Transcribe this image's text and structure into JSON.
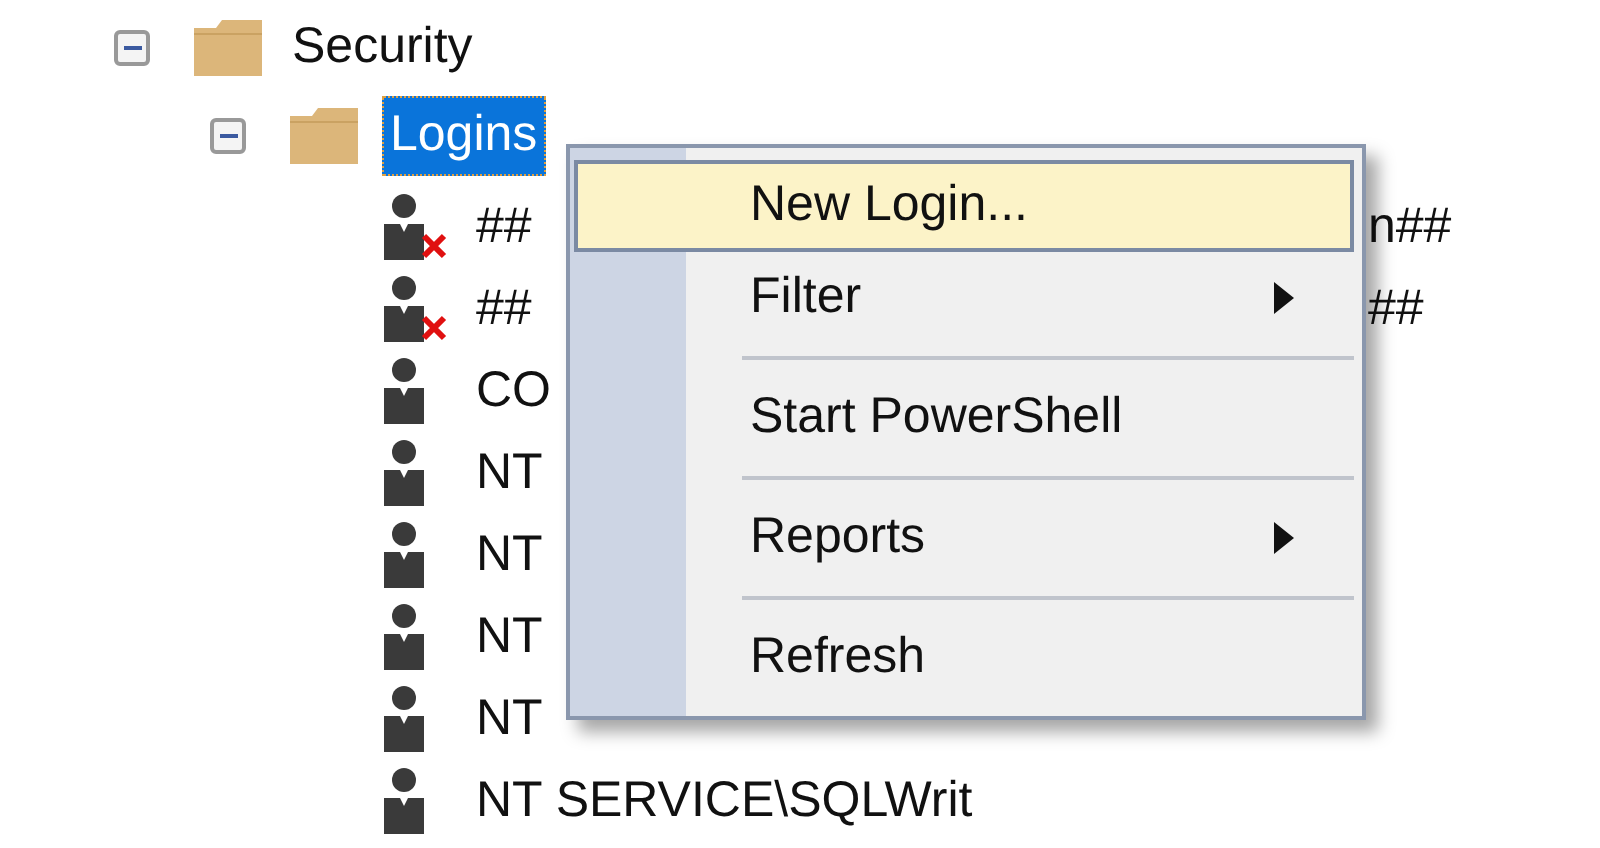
{
  "tree": {
    "label": "Security",
    "expanded": true,
    "children": [
      {
        "label": "Logins",
        "expanded": true,
        "selected": true,
        "children": [
          {
            "label": "##",
            "tail": "n##",
            "disabled": true
          },
          {
            "label": "##",
            "tail": "##",
            "disabled": true
          },
          {
            "label": "CO",
            "disabled": false
          },
          {
            "label": "NT",
            "disabled": false
          },
          {
            "label": "NT",
            "disabled": false
          },
          {
            "label": "NT",
            "disabled": false
          },
          {
            "label": "NT",
            "disabled": false
          },
          {
            "label": "NT SERVICE\\SQLWrit",
            "disabled": false
          }
        ]
      }
    ]
  },
  "context_menu": {
    "items": [
      {
        "kind": "item",
        "label": "New Login...",
        "selected": true,
        "submenu": false
      },
      {
        "kind": "item",
        "label": "Filter",
        "selected": false,
        "submenu": true
      },
      {
        "kind": "separator"
      },
      {
        "kind": "item",
        "label": "Start PowerShell",
        "selected": false,
        "submenu": false
      },
      {
        "kind": "separator"
      },
      {
        "kind": "item",
        "label": "Reports",
        "selected": false,
        "submenu": true
      },
      {
        "kind": "separator"
      },
      {
        "kind": "item",
        "label": "Refresh",
        "selected": false,
        "submenu": false
      }
    ]
  }
}
